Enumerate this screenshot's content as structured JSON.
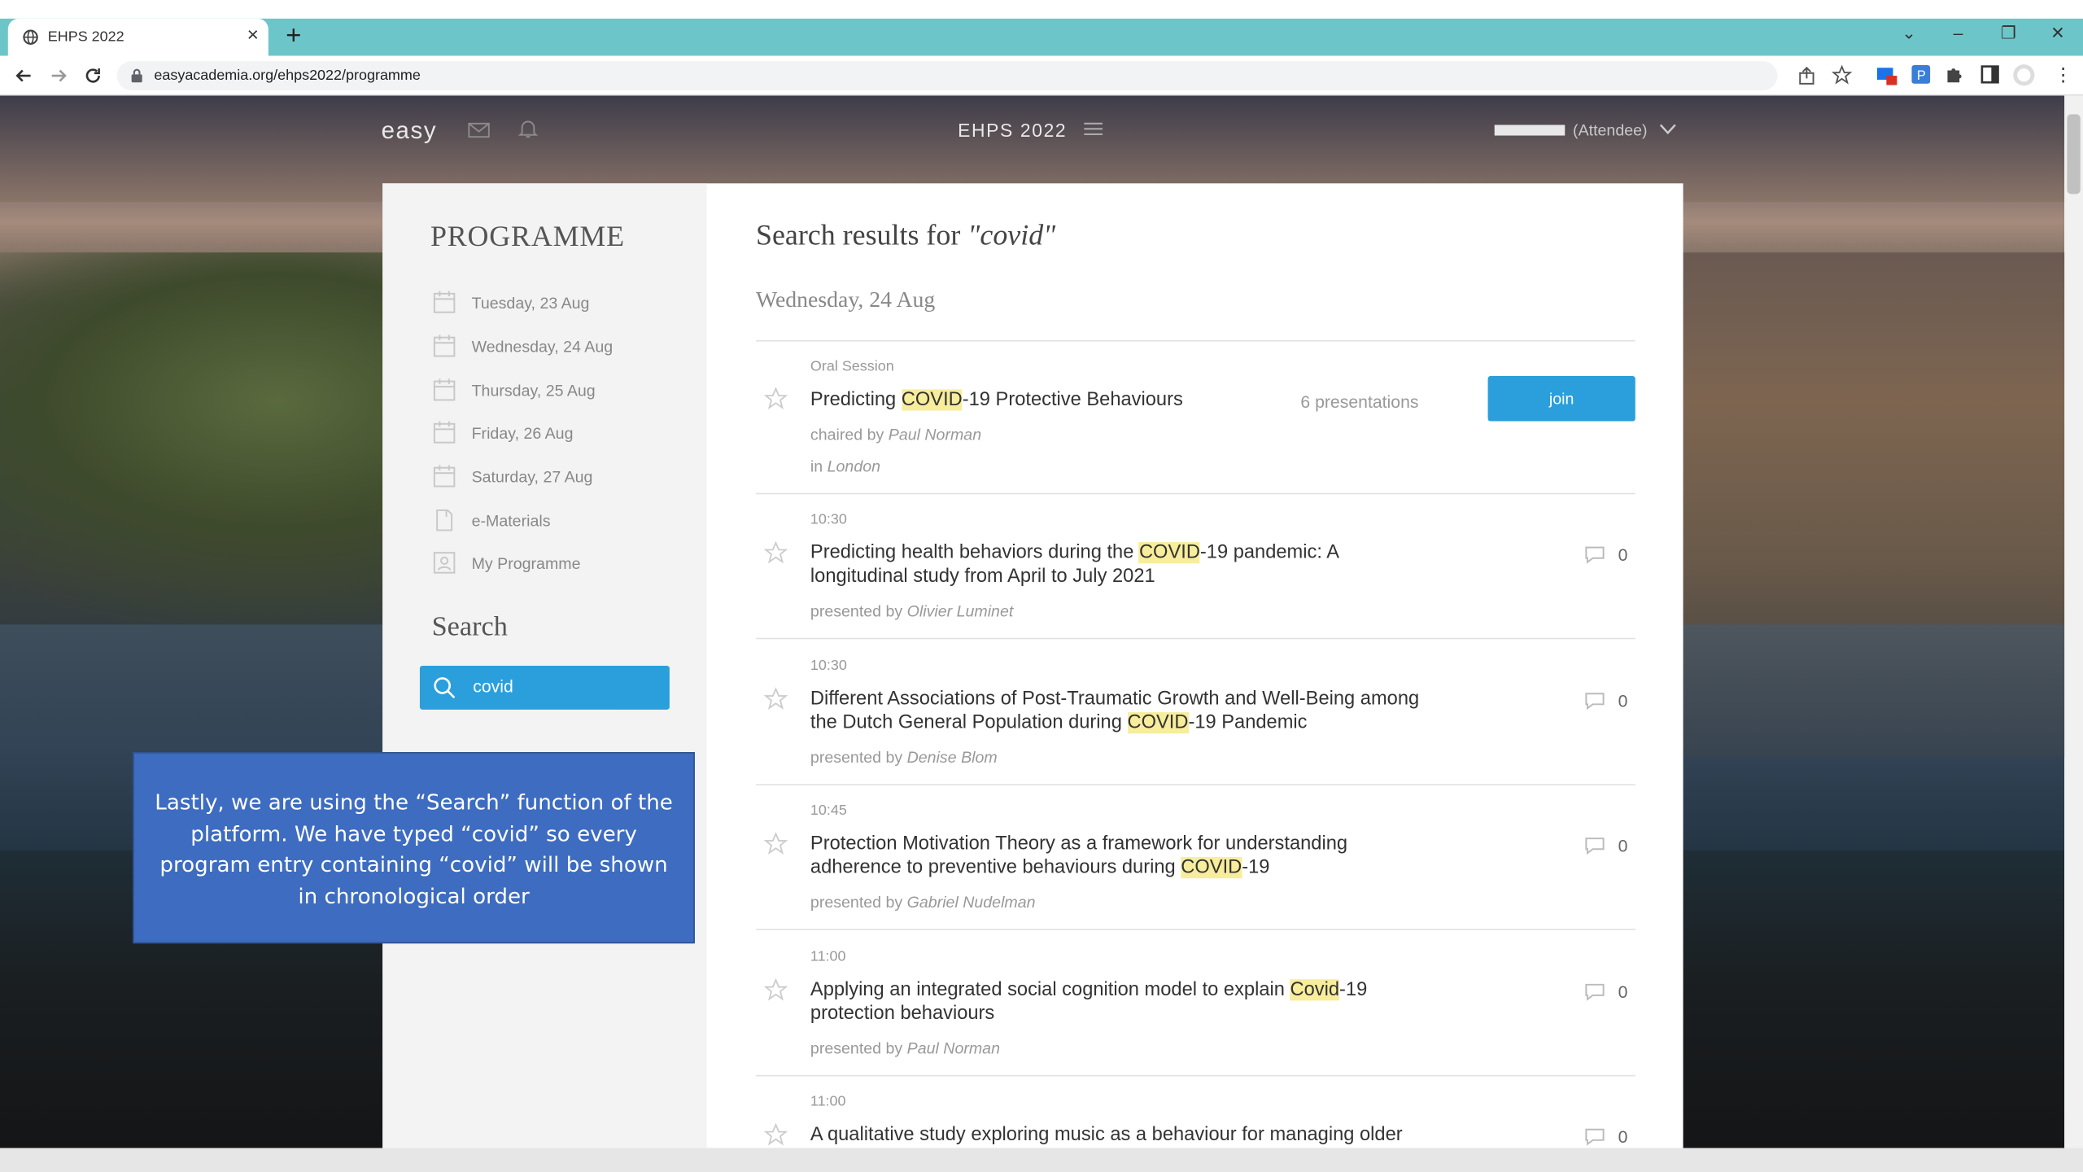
{
  "browser": {
    "tab_title": "EHPS 2022",
    "tab_close": "×",
    "new_tab": "+",
    "url": "easyacademia.org/ehps2022/programme",
    "win_dropdown": "⌄",
    "win_minimize": "–",
    "win_restore": "❐",
    "win_close": "✕"
  },
  "header": {
    "logo": "easy",
    "title": "EHPS 2022",
    "user_role": "(Attendee)"
  },
  "sidebar": {
    "heading": "PROGRAMME",
    "items": [
      {
        "label": "Tuesday, 23 Aug",
        "icon": "calendar-icon"
      },
      {
        "label": "Wednesday, 24 Aug",
        "icon": "calendar-icon"
      },
      {
        "label": "Thursday, 25 Aug",
        "icon": "calendar-icon"
      },
      {
        "label": "Friday, 26 Aug",
        "icon": "calendar-icon"
      },
      {
        "label": "Saturday, 27 Aug",
        "icon": "calendar-icon"
      },
      {
        "label": "e-Materials",
        "icon": "document-icon"
      },
      {
        "label": "My Programme",
        "icon": "person-icon"
      }
    ],
    "search_heading": "Search",
    "search_value": "covid"
  },
  "results": {
    "heading_prefix": "Search results for ",
    "heading_query": "\"covid\"",
    "day": "Wednesday, 24 Aug",
    "session": {
      "type": "Oral Session",
      "title_before": "Predicting ",
      "title_hl": "COVID",
      "title_after": "-19 Protective Behaviours",
      "count": "6 presentations",
      "join": "join",
      "chaired_prefix": "chaired by ",
      "chair": "Paul Norman",
      "in_prefix": "in ",
      "room": "London"
    },
    "presented_prefix": "presented by ",
    "items": [
      {
        "time": "10:30",
        "before": "Predicting health behaviors during the ",
        "hl": "COVID",
        "after": "-19 pandemic: A longitudinal study from April to July 2021",
        "author": "Olivier Luminet",
        "comments": "0"
      },
      {
        "time": "10:30",
        "before": "Different Associations of Post-Traumatic Growth and Well-Being among the Dutch General Population during ",
        "hl": "COVID",
        "after": "-19 Pandemic",
        "author": "Denise Blom",
        "comments": "0"
      },
      {
        "time": "10:45",
        "before": "Protection Motivation Theory as a framework for understanding adherence to preventive behaviours during ",
        "hl": "COVID",
        "after": "-19",
        "author": "Gabriel Nudelman",
        "comments": "0"
      },
      {
        "time": "11:00",
        "before": "Applying an integrated social cognition model to explain ",
        "hl": "Covid",
        "after": "-19 protection behaviours",
        "author": "Paul Norman",
        "comments": "0"
      },
      {
        "time": "11:00",
        "before": "A qualitative study exploring music as a behaviour for managing older",
        "hl": "",
        "after": "",
        "author": "",
        "comments": "0"
      }
    ]
  },
  "callout": {
    "text": "Lastly, we are using the “Search” function of the platform. We have typed “covid” so every program entry containing “covid” will be shown in chronological order"
  },
  "colors": {
    "accent": "#2a9fdc",
    "tabbar": "#6cc6c9",
    "highlight": "#f7ed9b",
    "callout": "#3d6cc1"
  }
}
